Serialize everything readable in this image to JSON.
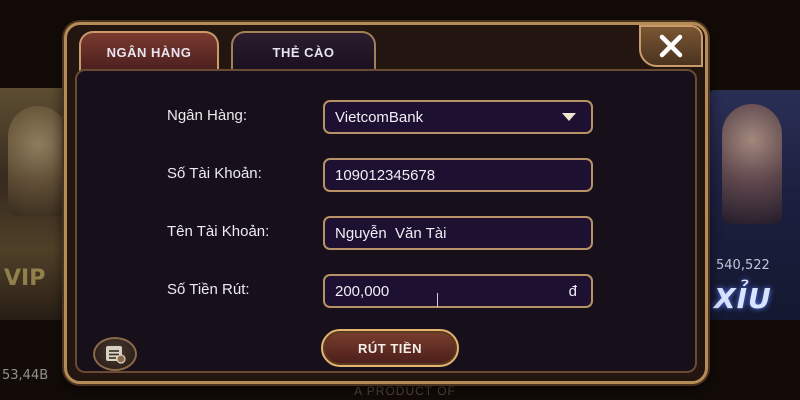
{
  "background": {
    "left_balance": "53,44B",
    "right_balance": "540,522",
    "right_game_name": "XỈU",
    "footer": "A PRODUCT OF"
  },
  "tabs": [
    {
      "label": "NGÂN HÀNG",
      "active": true
    },
    {
      "label": "THẺ CÀO",
      "active": false
    }
  ],
  "form": {
    "bank": {
      "label": "Ngân Hàng:",
      "value": "VietcomBank"
    },
    "account_number": {
      "label": "Số Tài Khoản:",
      "value": "109012345678"
    },
    "account_name": {
      "label": "Tên Tài Khoản:",
      "value": "Nguyễn  Văn Tài"
    },
    "amount": {
      "label": "Số Tiền Rút:",
      "value": "200,000",
      "currency": "đ"
    }
  },
  "withdraw_button": "RÚT TIỀN",
  "icons": {
    "close": "close-icon",
    "dropdown": "caret-down-icon",
    "history": "history-icon"
  },
  "colors": {
    "accent_gold": "#b58b56",
    "field_bg": "#1d1030",
    "active_tab": "#7a3a30"
  }
}
